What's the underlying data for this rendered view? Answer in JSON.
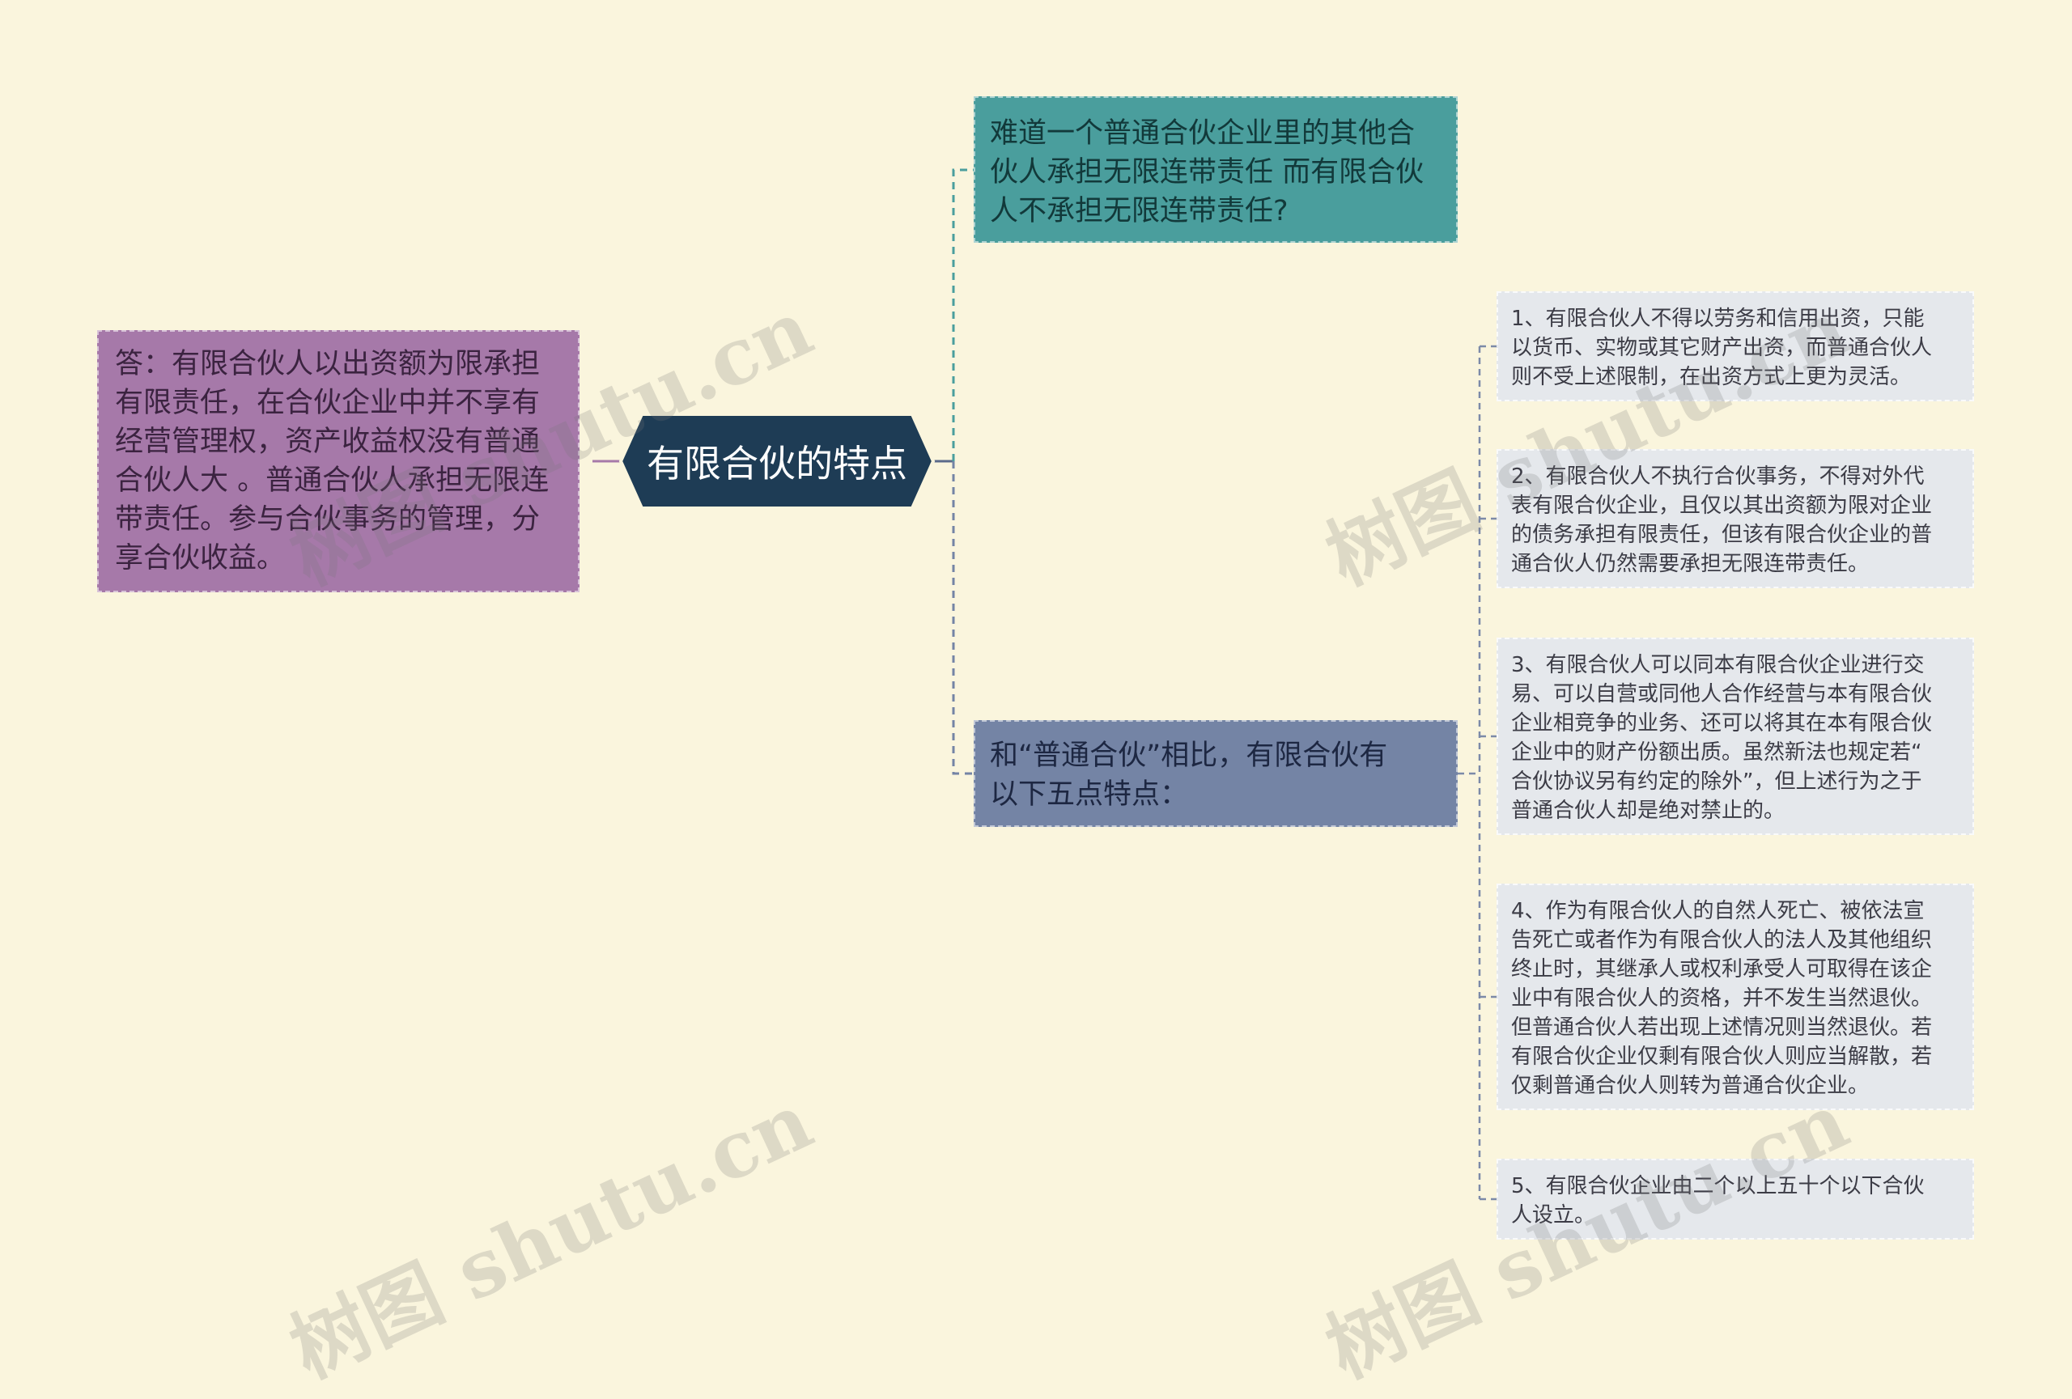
{
  "mindmap": {
    "root": {
      "label": "有限合伙的特点"
    },
    "answer": {
      "text": "答：有限合伙人以出资额为限承担\n有限责任，在合伙企业中并不享有\n经营管理权，资产收益权没有普通\n合伙人大 。普通合伙人承担无限连\n带责任。参与合伙事务的管理，分\n享合伙收益。"
    },
    "question": {
      "text": "难道一个普通合伙企业里的其他合\n伙人承担无限连带责任 而有限合伙\n人不承担无限连带责任?"
    },
    "compare": {
      "text": "和“普通合伙”相比，有限合伙有\n以下五点特点："
    },
    "points": [
      {
        "text": "1、有限合伙人不得以劳务和信用出资，只能\n以货币、实物或其它财产出资，而普通合伙人\n则不受上述限制，在出资方式上更为灵活。"
      },
      {
        "text": "2、有限合伙人不执行合伙事务，不得对外代\n表有限合伙企业，且仅以其出资额为限对企业\n的债务承担有限责任，但该有限合伙企业的普\n通合伙人仍然需要承担无限连带责任。"
      },
      {
        "text": "3、有限合伙人可以同本有限合伙企业进行交\n易、可以自营或同他人合作经营与本有限合伙\n企业相竞争的业务、还可以将其在本有限合伙\n企业中的财产份额出质。虽然新法也规定若“\n合伙协议另有约定的除外”，但上述行为之于\n普通合伙人却是绝对禁止的。"
      },
      {
        "text": "4、作为有限合伙人的自然人死亡、被依法宣\n告死亡或者作为有限合伙人的法人及其他组织\n终止时，其继承人或权利承受人可取得在该企\n业中有限合伙人的资格，并不发生当然退伙。\n但普通合伙人若出现上述情况则当然退伙。若\n有限合伙企业仅剩有限合伙人则应当解散，若\n仅剩普通合伙人则转为普通合伙企业。"
      },
      {
        "text": "5、有限合伙企业由二个以上五十个以下合伙\n人设立。"
      }
    ]
  },
  "watermark": {
    "text": "树图 shutu.cn"
  },
  "colors": {
    "background": "#faf5dd",
    "root_fill": "#1e3c55",
    "answer_fill": "#a679a9",
    "question_fill": "#4a9e9d",
    "compare_fill": "#7484a5",
    "point_fill": "#e5e8ec"
  }
}
